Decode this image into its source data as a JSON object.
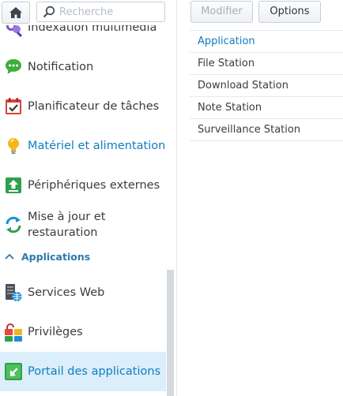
{
  "toolbar": {
    "search_placeholder": "Recherche"
  },
  "sidebar": {
    "items": [
      {
        "label": "Indexation multimédia",
        "icon": "media-indexing-icon"
      },
      {
        "label": "Notification",
        "icon": "notification-chat-icon"
      },
      {
        "label": "Planificateur de tâches",
        "icon": "calendar-check-icon"
      },
      {
        "label": "Matériel et alimentation",
        "icon": "lightbulb-icon"
      },
      {
        "label": "Périphériques externes",
        "icon": "upload-arrow-icon"
      },
      {
        "label_line1": "Mise à jour et",
        "label_line2": "restauration",
        "icon": "refresh-arrows-icon"
      }
    ],
    "section": {
      "label": "Applications"
    },
    "apps": [
      {
        "label": "Services Web",
        "icon": "web-server-icon"
      },
      {
        "label": "Privilèges",
        "icon": "privileges-blocks-icon"
      },
      {
        "label": "Portail des applications",
        "icon": "app-portal-icon"
      }
    ]
  },
  "main": {
    "buttons": {
      "modify": "Modifier",
      "options": "Options"
    },
    "rows": [
      "Application",
      "File Station",
      "Download Station",
      "Note Station",
      "Surveillance Station"
    ]
  },
  "colors": {
    "accent": "#0f7dc1",
    "selected_bg": "#dbeefa",
    "section": "#2d79b0"
  }
}
